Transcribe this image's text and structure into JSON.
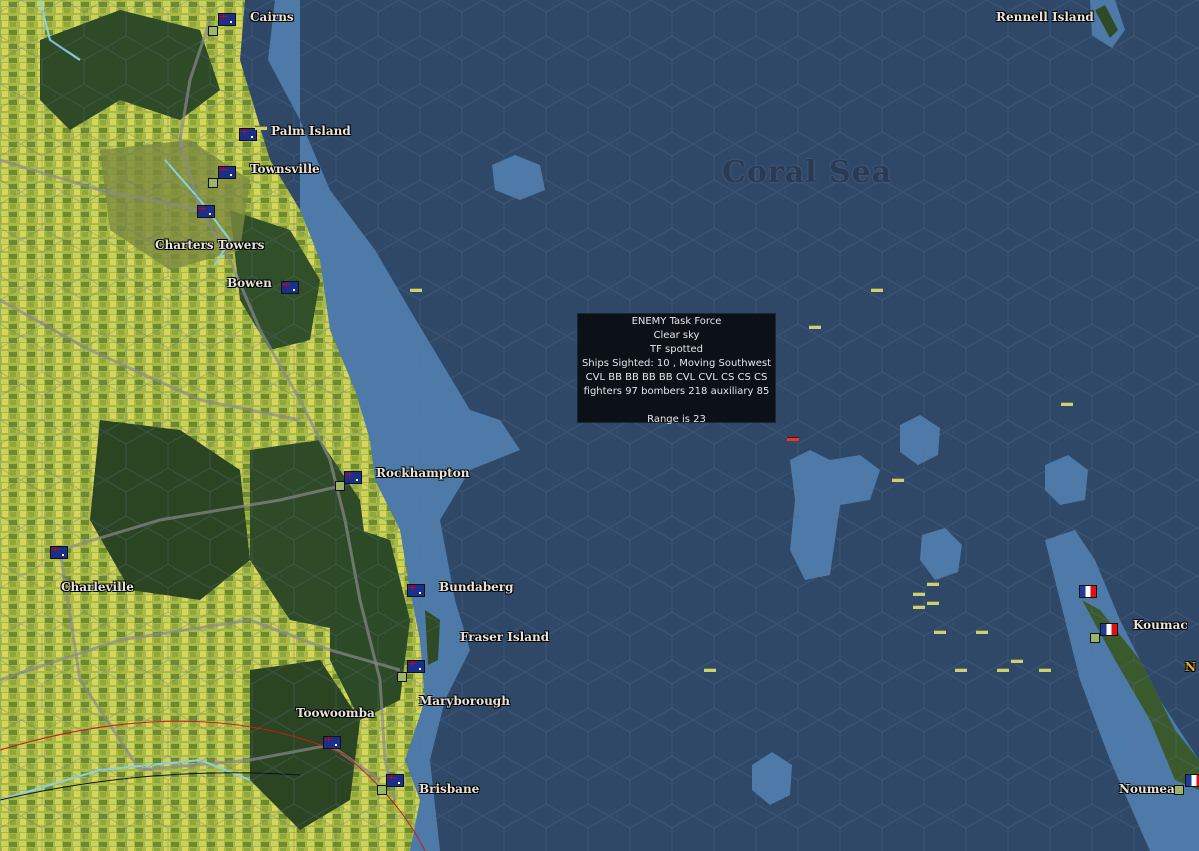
{
  "map": {
    "sea_label": "Coral Sea",
    "colors": {
      "ocean": "#2f4868",
      "shallow": "#4d7aa8",
      "land_light": "#b8c25a",
      "forest": "#2f4a26"
    }
  },
  "places": [
    {
      "id": "cairns",
      "label": "Cairns"
    },
    {
      "id": "palm-island",
      "label": "Palm Island"
    },
    {
      "id": "townsville",
      "label": "Townsville"
    },
    {
      "id": "charters-towers",
      "label": "Charters Towers"
    },
    {
      "id": "bowen",
      "label": "Bowen"
    },
    {
      "id": "rockhampton",
      "label": "Rockhampton"
    },
    {
      "id": "charleville",
      "label": "Charleville"
    },
    {
      "id": "bundaberg",
      "label": "Bundaberg"
    },
    {
      "id": "fraser-island",
      "label": "Fraser Island"
    },
    {
      "id": "maryborough",
      "label": "Maryborough"
    },
    {
      "id": "toowoomba",
      "label": "Toowoomba"
    },
    {
      "id": "brisbane",
      "label": "Brisbane"
    },
    {
      "id": "rennell-island",
      "label": "Rennell Island"
    },
    {
      "id": "koumac",
      "label": "Koumac"
    },
    {
      "id": "noumea",
      "label": "Noumea"
    },
    {
      "id": "edge-n",
      "label": "N"
    }
  ],
  "tooltip": {
    "title": "ENEMY Task Force",
    "weather": "Clear sky",
    "status": "TF spotted",
    "sighted": "Ships Sighted: 10 , Moving Southwest",
    "ships": "CVL BB BB BB BB CVL CVL CS CS CS",
    "aircraft": "fighters 97  bombers 218  auxiliary 85",
    "blank": "",
    "range": "Range is 23"
  },
  "icons": {
    "flag_aus": "australia-flag-icon",
    "flag_fra": "france-flag-icon",
    "base": "base-icon",
    "ship": "ship-icon",
    "enemy_tf": "enemy-task-force-icon"
  }
}
